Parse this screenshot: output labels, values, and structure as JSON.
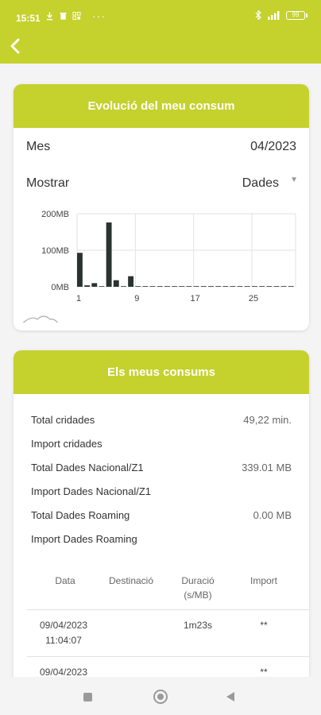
{
  "status": {
    "time": "15:51",
    "battery": "99",
    "dots": "···"
  },
  "card1": {
    "title": "Evolució del meu consum",
    "month_label": "Mes",
    "month_value": "04/2023",
    "show_label": "Mostrar",
    "show_value": "Dades"
  },
  "chart_data": {
    "type": "bar",
    "x": [
      1,
      2,
      3,
      4,
      5,
      6,
      7,
      8,
      9,
      10,
      11,
      12,
      13,
      14,
      15,
      16,
      17,
      18,
      19,
      20,
      21,
      22,
      23,
      24,
      25,
      26,
      27,
      28,
      29,
      30
    ],
    "values": [
      93,
      4,
      10,
      1,
      176,
      18,
      1,
      29,
      0.5,
      0.5,
      0.5,
      0.5,
      0.5,
      0.5,
      0.5,
      0.5,
      0.5,
      0.5,
      0.5,
      0.5,
      0.5,
      0.5,
      0.5,
      0.5,
      0.5,
      0.5,
      0.5,
      0.5,
      0.5,
      0.5
    ],
    "y_ticks": [
      "0MB",
      "100MB",
      "200MB"
    ],
    "x_ticks": [
      "1",
      "9",
      "17",
      "25"
    ],
    "ylim": [
      0,
      200
    ],
    "bar_color": "#2b3330",
    "grid": true
  },
  "card2": {
    "title": "Els meus consums",
    "stats": [
      {
        "label": "Total cridades",
        "value": "49,22 min."
      },
      {
        "label": "Import cridades",
        "value": ""
      },
      {
        "label": "Total Dades Nacional/Z1",
        "value": "339.01 MB"
      },
      {
        "label": "Import Dades Nacional/Z1",
        "value": ""
      },
      {
        "label": "Total Dades Roaming",
        "value": "0.00 MB"
      },
      {
        "label": "Import Dades Roaming",
        "value": ""
      }
    ],
    "headers": {
      "date": "Data",
      "dest": "Destinació",
      "duration_1": "Duració",
      "duration_2": "(s/MB)",
      "import": "Import"
    },
    "rows": [
      {
        "date": "09/04/2023",
        "time": "11:04:07",
        "dest": "",
        "duration": "1m23s",
        "import": "**"
      },
      {
        "date": "09/04/2023",
        "time": "",
        "dest": "",
        "duration": "",
        "import": "**"
      }
    ]
  }
}
